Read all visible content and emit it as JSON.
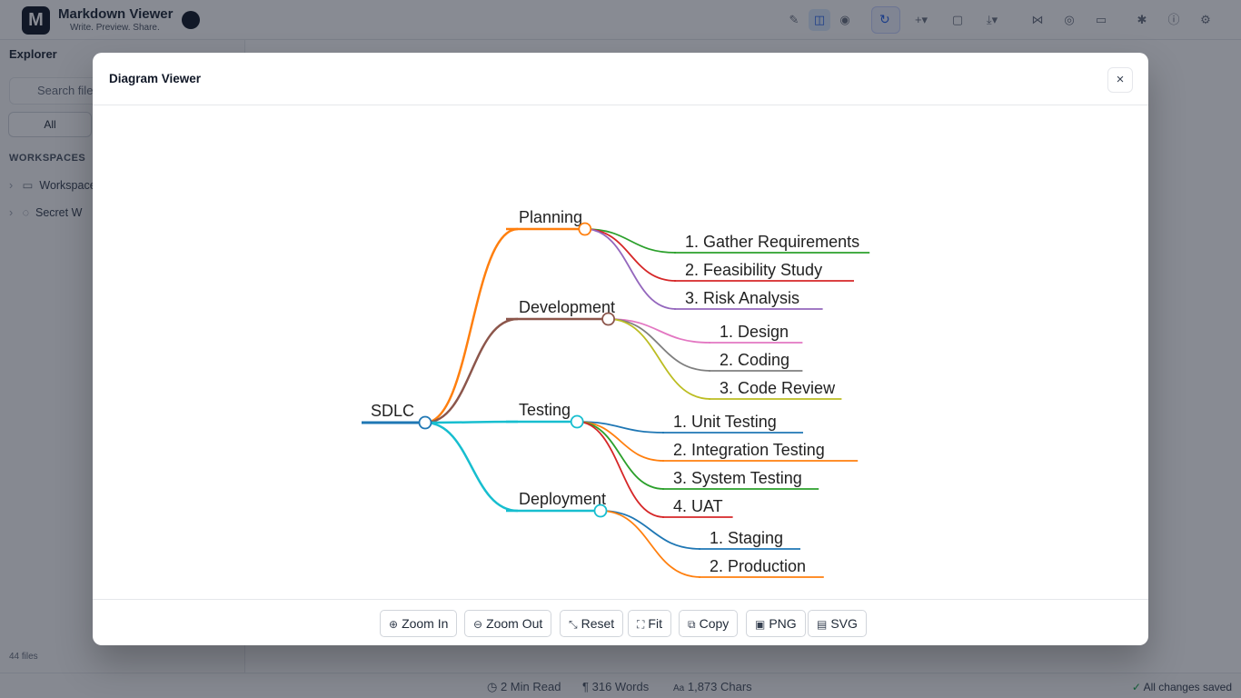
{
  "app": {
    "logo_letter": "M",
    "title": "Markdown Viewer",
    "subtitle": "Write. Preview. Share."
  },
  "sidebar": {
    "title": "Explorer",
    "search_placeholder": "Search files",
    "filter_tab": "All",
    "section_label": "WORKSPACES",
    "items": [
      "Workspace",
      "Secret W"
    ],
    "footer": "44 files"
  },
  "status": {
    "read_time": "2 Min Read",
    "words": "316 Words",
    "chars": "1,873 Chars",
    "saved": "All changes saved"
  },
  "modal": {
    "title": "Diagram Viewer",
    "close_label": "×",
    "toolbar": {
      "zoom_in": "Zoom In",
      "zoom_out": "Zoom Out",
      "reset": "Reset",
      "fit": "Fit",
      "copy": "Copy",
      "png": "PNG",
      "svg": "SVG"
    }
  },
  "mindmap": {
    "root": "SDLC",
    "root_color": "#1f77b4",
    "branches": [
      {
        "label": "Planning",
        "color": "#ff7f0e",
        "children": [
          {
            "label": "1. Gather Requirements",
            "color": "#2ca02c"
          },
          {
            "label": "2. Feasibility Study",
            "color": "#d62728"
          },
          {
            "label": "3. Risk Analysis",
            "color": "#9467bd"
          }
        ]
      },
      {
        "label": "Development",
        "color": "#8c564b",
        "children": [
          {
            "label": "1. Design",
            "color": "#e377c2"
          },
          {
            "label": "2. Coding",
            "color": "#7f7f7f"
          },
          {
            "label": "3. Code Review",
            "color": "#bcbd22"
          }
        ]
      },
      {
        "label": "Testing",
        "color": "#17becf",
        "children": [
          {
            "label": "1. Unit Testing",
            "color": "#1f77b4"
          },
          {
            "label": "2. Integration Testing",
            "color": "#ff7f0e"
          },
          {
            "label": "3. System Testing",
            "color": "#2ca02c"
          },
          {
            "label": "4. UAT",
            "color": "#d62728"
          }
        ]
      },
      {
        "label": "Deployment",
        "color": "#17becf",
        "children": [
          {
            "label": "1. Staging",
            "color": "#1f77b4"
          },
          {
            "label": "2. Production",
            "color": "#ff7f0e"
          }
        ]
      }
    ]
  }
}
